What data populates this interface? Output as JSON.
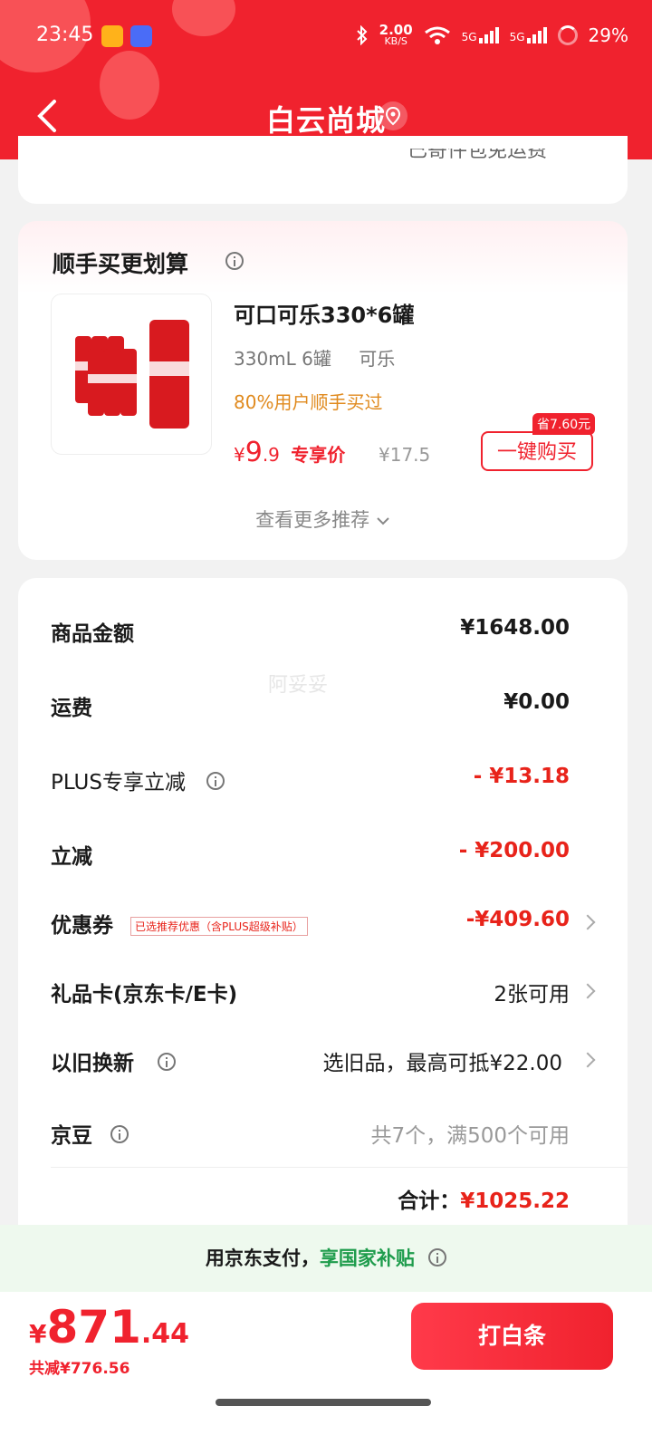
{
  "status_bar": {
    "time": "23:45",
    "net_speed_value": "2.00",
    "net_speed_unit": "KB/S",
    "signal_1": "5G",
    "signal_2": "5G",
    "battery": "29%"
  },
  "header": {
    "title": "白云尚城"
  },
  "top_card": {
    "cut_text": "已寄件包免运费"
  },
  "recommend": {
    "title": "顺手买更划算",
    "product": {
      "name": "可口可乐330*6罐",
      "spec_1": "330mL 6罐",
      "spec_2": "可乐",
      "hint": "80%用户顺手买过",
      "price_symbol": "¥",
      "price_int": "9",
      "price_dec": ".9",
      "price_label": "专享价",
      "original_price": "¥17.5",
      "save_badge": "省7.60元",
      "buy_label": "一键购买"
    },
    "more_label": "查看更多推荐"
  },
  "summary": {
    "watermark": "阿妥妥",
    "rows": [
      {
        "label": "商品金额",
        "value": "¥1648.00"
      },
      {
        "label": "运费",
        "value": "¥0.00"
      },
      {
        "label": "PLUS专享立减",
        "value": "- ¥13.18"
      },
      {
        "label": "立减",
        "value": "- ¥200.00"
      },
      {
        "label": "优惠券",
        "value": "-¥409.60",
        "tag": "已选推荐优惠（含PLUS超级补贴）"
      },
      {
        "label": "礼品卡(京东卡/E卡)",
        "value": "2张可用"
      },
      {
        "label": "以旧换新",
        "value": "选旧品，最高可抵¥22.00"
      },
      {
        "label": "京豆",
        "value": "共7个，满500个可用"
      }
    ],
    "total_label": "合计：",
    "total_value": "¥1025.22"
  },
  "promo": {
    "prefix": "用京东支付，",
    "highlight": "享国家补贴"
  },
  "footer": {
    "price_symbol": "¥",
    "price_int": "871",
    "price_dec": ".44",
    "saved": "共减¥776.56",
    "pay_label": "打白条"
  },
  "colors": {
    "brand_red": "#f0222e",
    "hint_orange": "#e08a1e",
    "promo_green": "#1e9c4c"
  }
}
